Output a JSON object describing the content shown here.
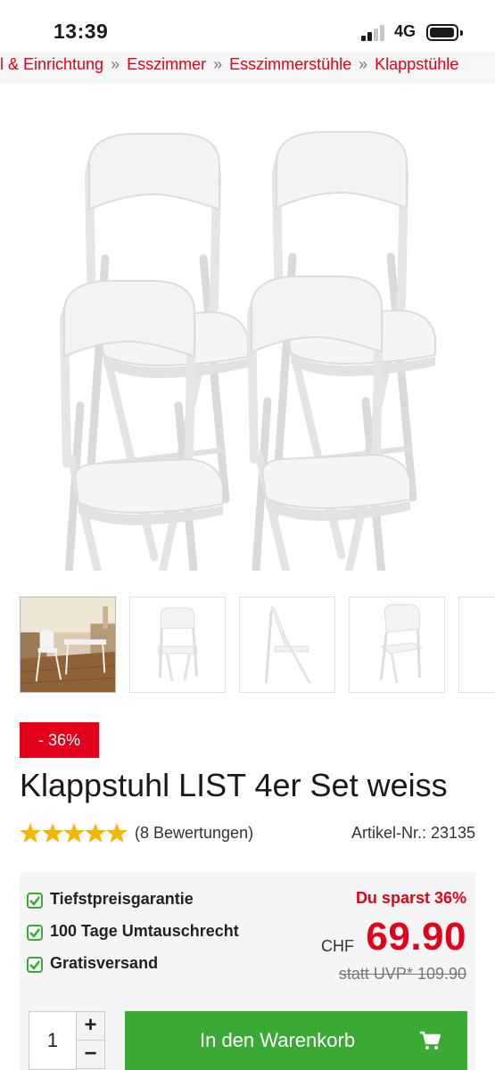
{
  "status_bar": {
    "time": "13:39",
    "network": "4G"
  },
  "breadcrumb": [
    "el & Einrichtung",
    "Esszimmer",
    "Esszimmerstühle",
    "Klappstühle"
  ],
  "breadcrumb_separator": "»",
  "product": {
    "discount_badge": "- 36%",
    "title": "Klappstuhl LIST 4er Set weiss",
    "rating_value": 5,
    "rating_count": "(8 Bewertungen)",
    "article_number": "Artikel-Nr.: 23135"
  },
  "benefits": [
    "Tiefstpreisgarantie",
    "100 Tage Umtauschrecht",
    "Gratisversand"
  ],
  "pricing": {
    "savings": "Du sparst 36%",
    "currency": "CHF",
    "price": "69.90",
    "old_price": "statt UVP* 109.90"
  },
  "purchase": {
    "quantity": "1",
    "plus": "+",
    "minus": "−",
    "cart_label": "In den Warenkorb"
  },
  "colors": {
    "accent_red": "#e3001b",
    "cart_green": "#3aa935",
    "star_yellow": "#f7b500",
    "check_green": "#3aa935"
  },
  "icons": [
    "signal-icon",
    "battery-icon",
    "star-icon",
    "check-icon",
    "cart-icon"
  ]
}
